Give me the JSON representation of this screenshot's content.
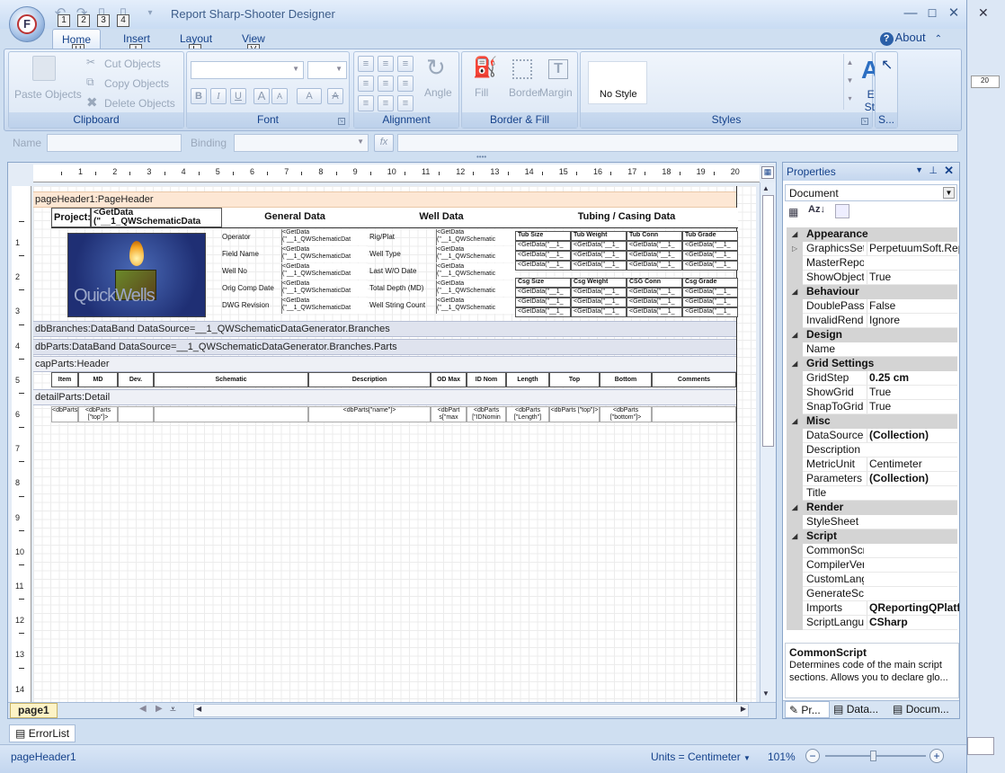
{
  "window": {
    "title": "Report Sharp-Shooter Designer",
    "min": "—",
    "max": "☐",
    "close": "✕"
  },
  "qat_keytips": [
    "1",
    "2",
    "3",
    "4"
  ],
  "tabs": [
    {
      "label": "Home",
      "keytip": "H"
    },
    {
      "label": "Insert",
      "keytip": "I"
    },
    {
      "label": "Layout",
      "keytip": "L"
    },
    {
      "label": "View",
      "keytip": "V"
    }
  ],
  "about": "About",
  "ribbon": {
    "clipboard": {
      "label": "Clipboard",
      "paste": "Paste Objects",
      "cut": "Cut Objects",
      "copy": "Copy Objects",
      "delete": "Delete Objects"
    },
    "font": {
      "label": "Font",
      "bold": "B",
      "italic": "I",
      "underline": "U",
      "grow": "A",
      "shrink": "A",
      "color": "A",
      "clear": "A"
    },
    "alignment": {
      "label": "Alignment",
      "angle": "Angle"
    },
    "border_fill": {
      "label": "Border & Fill",
      "fill": "Fill",
      "border": "Border",
      "margin": "Margin"
    },
    "styles": {
      "label": "Styles",
      "gallery_item": "No Style",
      "edit": "Edit Style"
    },
    "select": {
      "label": "S..."
    }
  },
  "namebar": {
    "name_label": "Name",
    "binding_label": "Binding",
    "fx": "fx"
  },
  "ruler_top": [
    "1",
    "2",
    "3",
    "4",
    "5",
    "6",
    "7",
    "8",
    "9",
    "10",
    "11",
    "12",
    "13",
    "14",
    "15",
    "16",
    "17",
    "18",
    "19",
    "20"
  ],
  "ruler_left": [
    "1",
    "2",
    "3",
    "4",
    "5",
    "6",
    "7",
    "8",
    "9",
    "10",
    "11",
    "12",
    "13",
    "14"
  ],
  "ghost_ruler": "20",
  "report": {
    "bands": {
      "page_header": "pageHeader1:PageHeader",
      "db_branches": "dbBranches:DataBand DataSource=__1_QWSchematicDataGenerator.Branches",
      "db_parts": "dbParts:DataBand DataSource=__1_QWSchematicDataGenerator.Branches.Parts",
      "cap_parts": "capParts:Header",
      "detail_parts": "detailParts:Detail"
    },
    "project_label": "Project:",
    "project_value": "<GetData (\"__1_QWSchematicData",
    "logo_text": "QuickWells",
    "sections": {
      "general": "General Data",
      "well": "Well Data",
      "tubing": "Tubing / Casing Data"
    },
    "general_rows": [
      "Operator",
      "Field Name",
      "Well No",
      "Orig Comp Date",
      "DWG Revision"
    ],
    "well_rows": [
      "Rig/Plat",
      "Well Type",
      "Last W/O Date",
      "Total Depth (MD)",
      "Well String Count"
    ],
    "getdata_text": "<GetData (\"__1_QWSchematicDat",
    "getdata_text2": "<GetData (\"__1_QWSchematic",
    "tub_headers": [
      "Tub Size",
      "Tub Weight",
      "Tub Conn",
      "Tub Grade"
    ],
    "csg_headers": [
      "Csg Size",
      "Csg Weight",
      "CSG Conn",
      "Csg Grade"
    ],
    "tub_cell": "<GetData(\"__1_",
    "col_headers": [
      "Item",
      "MD",
      "Dev.",
      "Schematic",
      "Description",
      "OD Max",
      "ID Nom",
      "Length",
      "Top",
      "Bottom",
      "Comments"
    ],
    "detail_cells": [
      "<dbParts[\"Un",
      "<dbParts [\"top\"]>",
      "",
      "",
      "<dbParts[\"name\"]>",
      "<dbPart s[\"max",
      "<dbParts [\"IDNomin",
      "<dbParts [\"Length\"]",
      "<dbParts [\"top\"]>",
      "<dbParts [\"bottom\"]>",
      ""
    ]
  },
  "page_tab": "page1",
  "properties": {
    "title": "Properties",
    "selector": "Document",
    "categories": [
      {
        "name": "Appearance",
        "rows": [
          [
            "GraphicsSet",
            "PerpetuumSoft.Repor"
          ],
          [
            "MasterRepor",
            ""
          ],
          [
            "ShowObjectI",
            "True"
          ]
        ]
      },
      {
        "name": "Behaviour",
        "rows": [
          [
            "DoublePass",
            "False"
          ],
          [
            "InvalidRende",
            "Ignore"
          ]
        ]
      },
      {
        "name": "Design",
        "rows": [
          [
            "Name",
            ""
          ]
        ]
      },
      {
        "name": "Grid Settings",
        "rows": [
          [
            "GridStep",
            "0.25 cm"
          ],
          [
            "ShowGrid",
            "True"
          ],
          [
            "SnapToGrid",
            "True"
          ]
        ]
      },
      {
        "name": "Misc",
        "rows": [
          [
            "DataSources",
            "(Collection)"
          ],
          [
            "Description",
            ""
          ],
          [
            "MetricUnit",
            "Centimeter"
          ],
          [
            "Parameters",
            "(Collection)"
          ],
          [
            "Title",
            ""
          ]
        ]
      },
      {
        "name": "Render",
        "rows": [
          [
            "StyleSheet",
            ""
          ]
        ]
      },
      {
        "name": "Script",
        "rows": [
          [
            "CommonScr",
            ""
          ],
          [
            "CompilerVer",
            ""
          ],
          [
            "CustomLang",
            ""
          ],
          [
            "GenerateScr",
            ""
          ],
          [
            "Imports",
            "QReportingQPlatfo"
          ],
          [
            "ScriptLangua",
            "CSharp"
          ]
        ]
      }
    ],
    "bold_values": [
      "0.25 cm",
      "(Collection)",
      "QReportingQPlatfo",
      "CSharp"
    ],
    "desc_title": "CommonScript",
    "desc_text": "Determines code of the main script sections. Allows you to declare glo...",
    "bottom_tabs": [
      "Pr...",
      "Data...",
      "Docum..."
    ]
  },
  "error_tab": "ErrorList",
  "status": {
    "left": "pageHeader1",
    "units": "Units = Centimeter",
    "zoom": "101%"
  }
}
